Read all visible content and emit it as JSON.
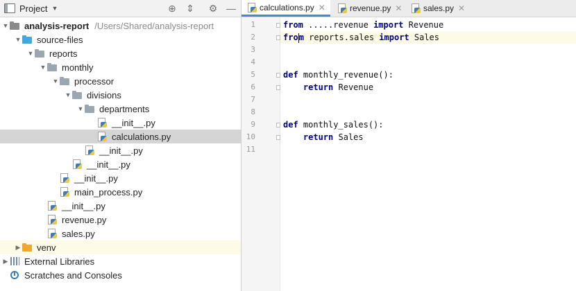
{
  "sidebar": {
    "title": "Project",
    "tree": [
      {
        "label": "analysis-report",
        "path": "/Users/Shared/analysis-report",
        "icon": "folder-icon",
        "depth": 0,
        "expanded": true
      },
      {
        "label": "source-files",
        "icon": "folder-icon",
        "depth": 1,
        "expanded": true
      },
      {
        "label": "reports",
        "icon": "folder-icon",
        "depth": 2,
        "expanded": true
      },
      {
        "label": "monthly",
        "icon": "folder-icon",
        "depth": 3,
        "expanded": true
      },
      {
        "label": "processor",
        "icon": "folder-icon",
        "depth": 4,
        "expanded": true
      },
      {
        "label": "divisions",
        "icon": "folder-icon",
        "depth": 5,
        "expanded": true
      },
      {
        "label": "departments",
        "icon": "folder-icon",
        "depth": 6,
        "expanded": true
      },
      {
        "label": "__init__.py",
        "icon": "python-file-icon",
        "depth": 7
      },
      {
        "label": "calculations.py",
        "icon": "python-file-icon",
        "depth": 7,
        "selected": true
      },
      {
        "label": "__init__.py",
        "icon": "python-file-icon",
        "depth": 6
      },
      {
        "label": "__init__.py",
        "icon": "python-file-icon",
        "depth": 5
      },
      {
        "label": "__init__.py",
        "icon": "python-file-icon",
        "depth": 4
      },
      {
        "label": "main_process.py",
        "icon": "python-file-icon",
        "depth": 4
      },
      {
        "label": "__init__.py",
        "icon": "python-file-icon",
        "depth": 3
      },
      {
        "label": "revenue.py",
        "icon": "python-file-icon",
        "depth": 3
      },
      {
        "label": "sales.py",
        "icon": "python-file-icon",
        "depth": 3
      },
      {
        "label": "venv",
        "icon": "folder-icon",
        "depth": 1,
        "expanded": false
      },
      {
        "label": "External Libraries",
        "icon": "library-icon",
        "depth": 0,
        "expanded": false
      },
      {
        "label": "Scratches and Consoles",
        "icon": "scratch-icon",
        "depth": 0
      }
    ]
  },
  "tabs": [
    {
      "label": "calculations.py",
      "active": true
    },
    {
      "label": "revenue.py",
      "active": false
    },
    {
      "label": "sales.py",
      "active": false
    }
  ],
  "editor": {
    "current_line": 2,
    "lines": [
      [
        {
          "k": true,
          "t": "from"
        },
        {
          "t": " .....revenue "
        },
        {
          "k": true,
          "t": "import"
        },
        {
          "t": " Revenue"
        }
      ],
      [
        {
          "k": true,
          "t": "from"
        },
        {
          "t": " reports.sales "
        },
        {
          "k": true,
          "t": "import"
        },
        {
          "t": " Sales"
        }
      ],
      [],
      [],
      [
        {
          "k": true,
          "t": "def"
        },
        {
          "t": " monthly_revenue():"
        }
      ],
      [
        {
          "t": "    "
        },
        {
          "k": true,
          "t": "return"
        },
        {
          "t": " Revenue"
        }
      ],
      [],
      [],
      [
        {
          "k": true,
          "t": "def"
        },
        {
          "t": " monthly_sales():"
        }
      ],
      [
        {
          "t": "    "
        },
        {
          "k": true,
          "t": "return"
        },
        {
          "t": " Sales"
        }
      ],
      []
    ]
  }
}
